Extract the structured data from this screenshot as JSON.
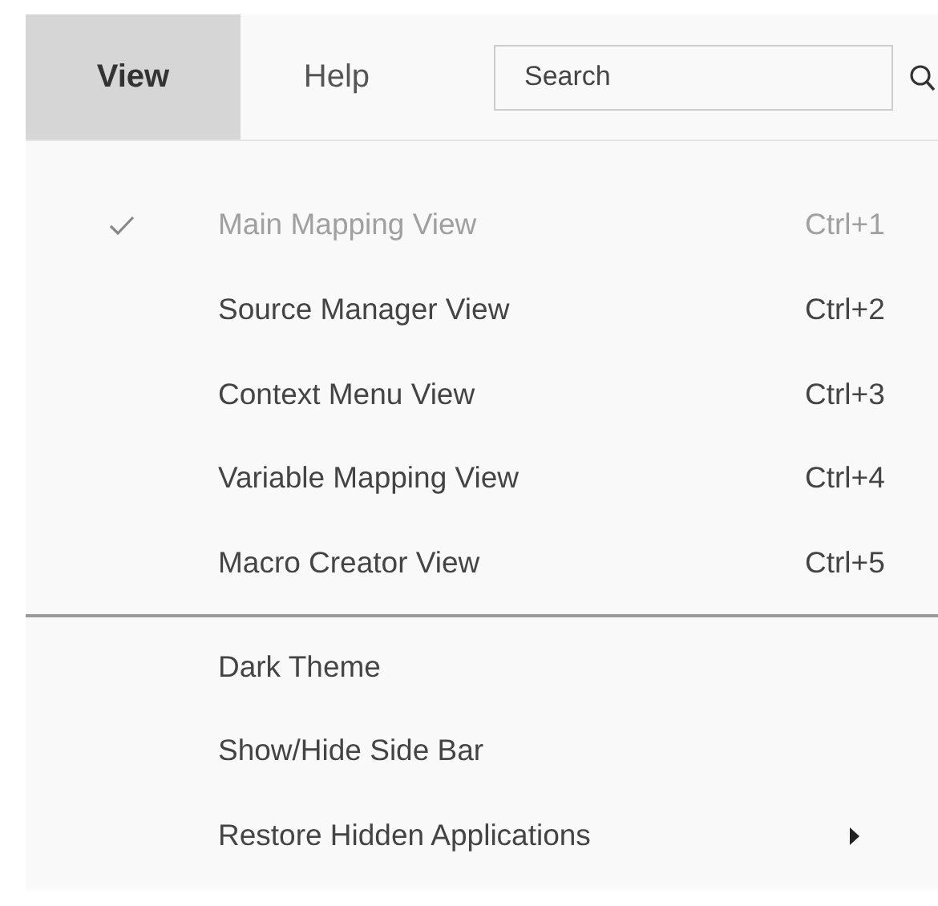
{
  "menubar": {
    "tabs": [
      {
        "label": "View",
        "selected": true
      },
      {
        "label": "Help",
        "selected": false
      }
    ],
    "search": {
      "placeholder": "Search"
    }
  },
  "menu": {
    "sections": [
      {
        "items": [
          {
            "kind": "item",
            "label": "Main Mapping View",
            "shortcut": "Ctrl+1",
            "checked": true,
            "disabled": true
          },
          {
            "kind": "item",
            "label": "Source Manager View",
            "shortcut": "Ctrl+2",
            "checked": false,
            "disabled": false
          },
          {
            "kind": "item",
            "label": "Context Menu View",
            "shortcut": "Ctrl+3",
            "checked": false,
            "disabled": false
          },
          {
            "kind": "item",
            "label": "Variable Mapping View",
            "shortcut": "Ctrl+4",
            "checked": false,
            "disabled": false
          },
          {
            "kind": "item",
            "label": "Macro Creator View",
            "shortcut": "Ctrl+5",
            "checked": false,
            "disabled": false
          }
        ]
      },
      {
        "items": [
          {
            "kind": "item",
            "label": "Dark Theme",
            "checked": false,
            "disabled": false
          },
          {
            "kind": "item",
            "label": "Show/Hide Side Bar",
            "checked": false,
            "disabled": false
          },
          {
            "kind": "submenu",
            "label": "Restore Hidden Applications",
            "checked": false,
            "disabled": false
          }
        ]
      }
    ]
  }
}
